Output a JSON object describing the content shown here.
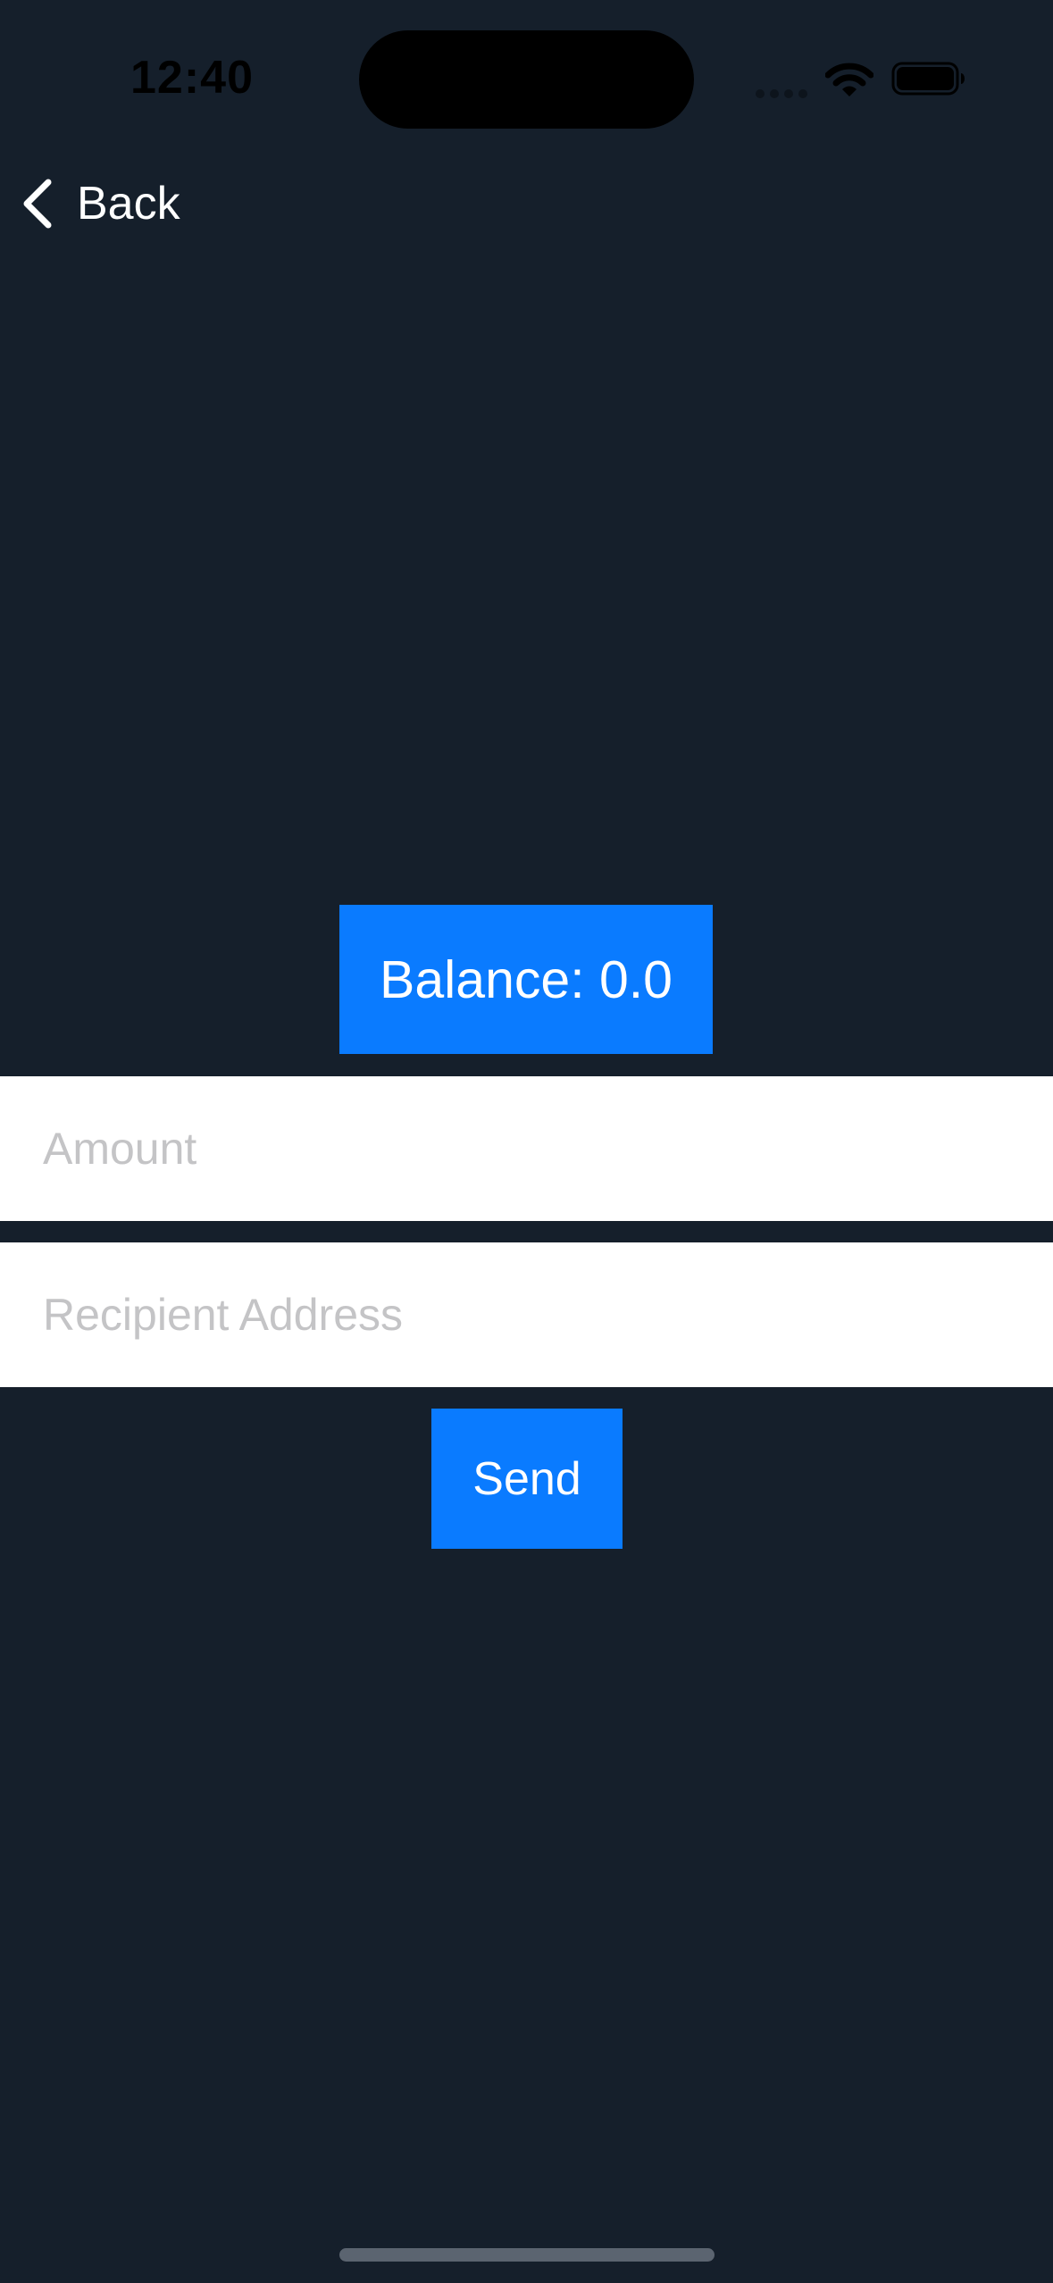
{
  "status_bar": {
    "time": "12:40",
    "signal_icon": "cellular-signal-icon",
    "wifi_icon": "wifi-icon",
    "battery_icon": "battery-icon"
  },
  "nav": {
    "back_label": "Back",
    "back_icon": "chevron-left-icon"
  },
  "wallet": {
    "balance_text": "Balance: 0.0"
  },
  "form": {
    "amount_value": "",
    "amount_placeholder": "Amount",
    "address_value": "",
    "address_placeholder": "Recipient Address",
    "send_label": "Send"
  },
  "colors": {
    "background": "#151f2b",
    "accent": "#0a7bff",
    "field_background": "#ffffff",
    "placeholder": "#c4c4c6"
  }
}
